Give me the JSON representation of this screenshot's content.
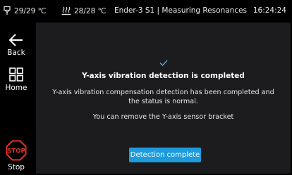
{
  "statusbar": {
    "nozzle_temp": "29/29 ℃",
    "bed_temp": "28/28 ℃",
    "title": "Ender-3 S1 | Measuring Resonances",
    "time": "16:24:24"
  },
  "sidebar": {
    "back_label": "Back",
    "home_label": "Home",
    "stop_label": "Stop",
    "stop_icon_text": "STOP"
  },
  "dialog": {
    "title": "Y-axis vibration detection is completed",
    "body": "Y-axis vibration compensation detection has been completed and the status is normal.",
    "hint": "You can remove the Y-axis sensor bracket",
    "button_label": "Detection complete"
  },
  "colors": {
    "accent": "#1c9cde",
    "stop_red": "#e0302a",
    "panel_bg": "#1c1c1e",
    "check_color": "#2fb8e6"
  }
}
